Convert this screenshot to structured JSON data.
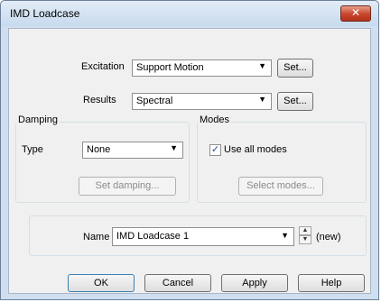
{
  "window": {
    "title": "IMD Loadcase",
    "close_glyph": "✕"
  },
  "excitation": {
    "label": "Excitation",
    "value": "Support Motion",
    "set_label": "Set..."
  },
  "results": {
    "label": "Results",
    "value": "Spectral",
    "set_label": "Set..."
  },
  "damping": {
    "group_title": "Damping",
    "type_label": "Type",
    "type_value": "None",
    "set_damping_label": "Set damping..."
  },
  "modes": {
    "group_title": "Modes",
    "use_all_label": "Use all modes",
    "use_all_checked": true,
    "select_modes_label": "Select modes..."
  },
  "name": {
    "label": "Name",
    "value": "IMD Loadcase 1",
    "status": "(new)"
  },
  "buttons": {
    "ok": "OK",
    "cancel": "Cancel",
    "apply": "Apply",
    "help": "Help"
  }
}
